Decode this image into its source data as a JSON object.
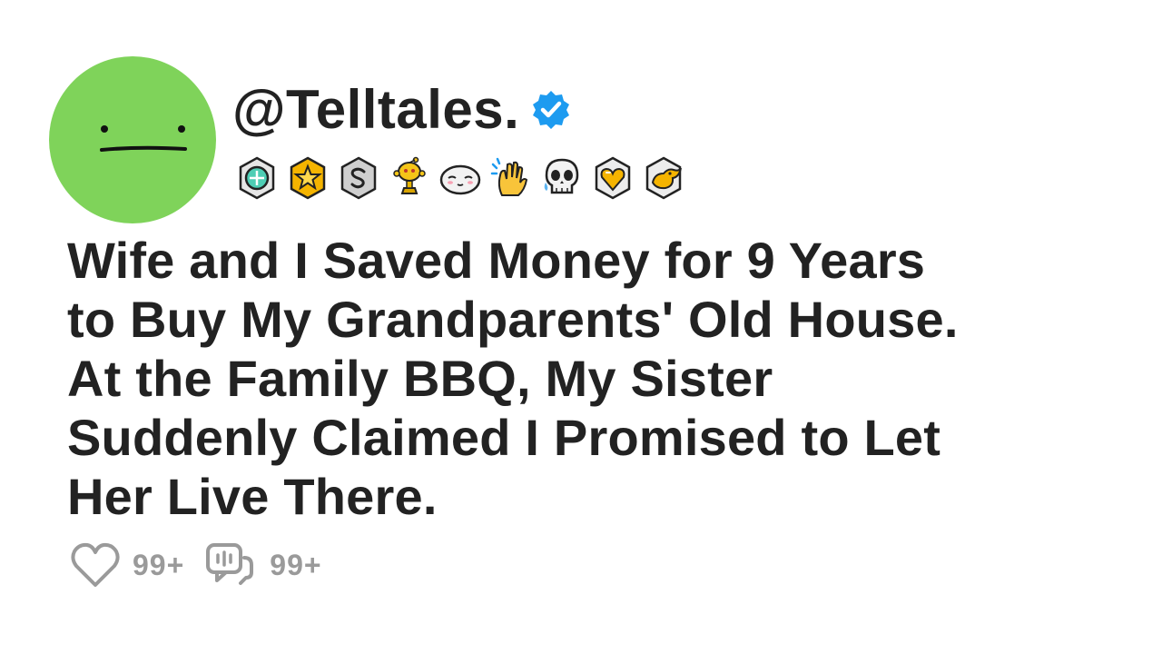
{
  "profile": {
    "username": "@Telltales.",
    "verified": true,
    "avatar_color": "#7fd35a",
    "verified_color": "#1d9bf0"
  },
  "badges": [
    {
      "icon": "helper-award-icon"
    },
    {
      "icon": "gold-star-award-icon"
    },
    {
      "icon": "silver-s-award-icon"
    },
    {
      "icon": "snoo-trophy-award-icon"
    },
    {
      "icon": "blushing-seal-award-icon"
    },
    {
      "icon": "clapping-hands-award-icon"
    },
    {
      "icon": "crying-skull-award-icon"
    },
    {
      "icon": "gold-heart-gem-award-icon"
    },
    {
      "icon": "silver-duck-award-icon"
    }
  ],
  "post": {
    "title_lines": [
      "Wife and I Saved Money for 9 Years",
      "to Buy My Grandparents' Old House.",
      "At the Family BBQ, My Sister",
      "Suddenly Claimed I Promised to Let",
      "Her Live There."
    ]
  },
  "stats": {
    "likes": "99+",
    "comments": "99+",
    "like_icon": "heart-icon",
    "comment_icon": "comment-icon"
  }
}
